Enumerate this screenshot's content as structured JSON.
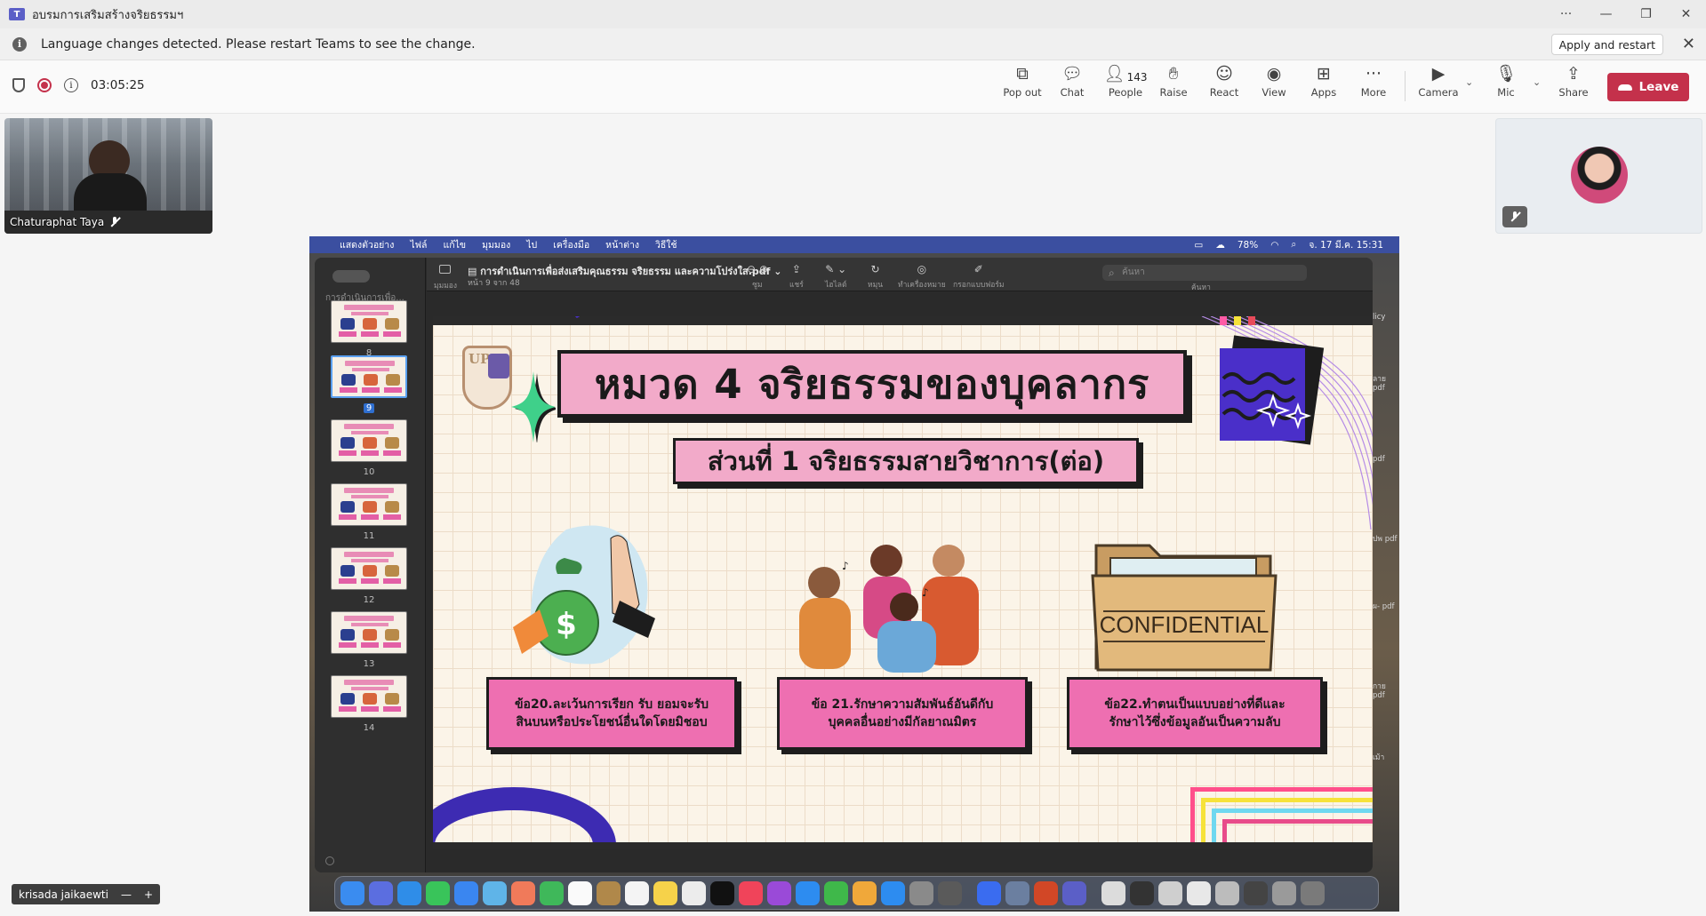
{
  "window": {
    "title": "อบรมการเสริมสร้างจริยธรรมฯ",
    "controls": [
      "···",
      "—",
      "❐",
      "✕"
    ]
  },
  "banner": {
    "message": "Language changes detected. Please restart Teams to see the change.",
    "apply_label": "Apply and restart"
  },
  "meeting": {
    "elapsed": "03:05:25",
    "tools": [
      {
        "label": "Pop out",
        "icon": "popout-icon"
      },
      {
        "label": "Chat",
        "icon": "chat-icon"
      },
      {
        "label": "People",
        "icon": "people-icon",
        "count": "143"
      },
      {
        "label": "Raise",
        "icon": "raise-hand-icon"
      },
      {
        "label": "React",
        "icon": "react-icon"
      },
      {
        "label": "View",
        "icon": "view-icon"
      },
      {
        "label": "Apps",
        "icon": "apps-icon"
      },
      {
        "label": "More",
        "icon": "more-icon"
      },
      {
        "label": "Camera",
        "icon": "camera-off-icon"
      },
      {
        "label": "Mic",
        "icon": "mic-off-icon"
      },
      {
        "label": "Share",
        "icon": "share-icon"
      }
    ],
    "leave_label": "Leave",
    "leave_color": "#c4314b"
  },
  "participants": {
    "host_name": "Chaturaphat Taya",
    "caption_name": "krisada jaikaewti"
  },
  "mac": {
    "menus": [
      "แสดงตัวอย่าง",
      "ไฟล์",
      "แก้ไข",
      "มุมมอง",
      "ไป",
      "เครื่องมือ",
      "หน้าต่าง",
      "วิธีใช้"
    ],
    "battery": "78%",
    "datetime": "จ. 17 มี.ค. 15:31"
  },
  "preview": {
    "filename": "การดำเนินการเพื่อส่งเสริมคุณธรรม จริยธรรม และความโปร่งใส.pdf",
    "page_info": "หน้า 9 จาก 48",
    "view_label": "มุมมอง",
    "sidebar_doc": "การดำเนินการเพื่อ...",
    "search_placeholder": "ค้นหา",
    "search_label": "ค้นหา",
    "toolbar": [
      {
        "label": "ซูม"
      },
      {
        "label": "แชร์"
      },
      {
        "label": "ไฮไลต์"
      },
      {
        "label": "หมุน"
      },
      {
        "label": "ทำเครื่องหมาย"
      },
      {
        "label": "กรอกแบบฟอร์ม"
      }
    ],
    "thumbnails": [
      {
        "page": "8"
      },
      {
        "page": "9",
        "active": true
      },
      {
        "page": "10"
      },
      {
        "page": "11"
      },
      {
        "page": "12"
      },
      {
        "page": "13"
      },
      {
        "page": "14"
      }
    ]
  },
  "slide": {
    "logo_text": "UP",
    "title": "หมวด 4 จริยธรรมของบุคลากร",
    "subtitle": "ส่วนที่ 1 จริยธรรมสายวิชาการ(ต่อ)",
    "confidential_label": "CONFIDENTIAL",
    "cards": [
      {
        "line1": "ข้อ20.ละเว้นการเรียก รับ ยอมจะรับ",
        "line2": "สินบนหรือประโยชน์อื่นใดโดยมิชอบ"
      },
      {
        "line1": "ข้อ 21.รักษาความสัมพันธ์อันดีกับ",
        "line2": "บุคคลอื่นอย่างมีกัลยาณมิตร"
      },
      {
        "line1": "ข้อ22.ทำตนเป็นแบบอย่างที่ดีและ",
        "line2": "รักษาไว้ซึ่งข้อมูลอันเป็นความลับ"
      }
    ],
    "colors": {
      "card_pink": "#ee6fb1",
      "title_pink": "#f2aac9",
      "purple": "#4a2fc9"
    }
  },
  "finder_right": [
    "licy",
    "ลาย pdf",
    "pdf",
    "ปพ pdf",
    "ผ- pdf",
    "กาย pdf",
    "เม้า"
  ]
}
